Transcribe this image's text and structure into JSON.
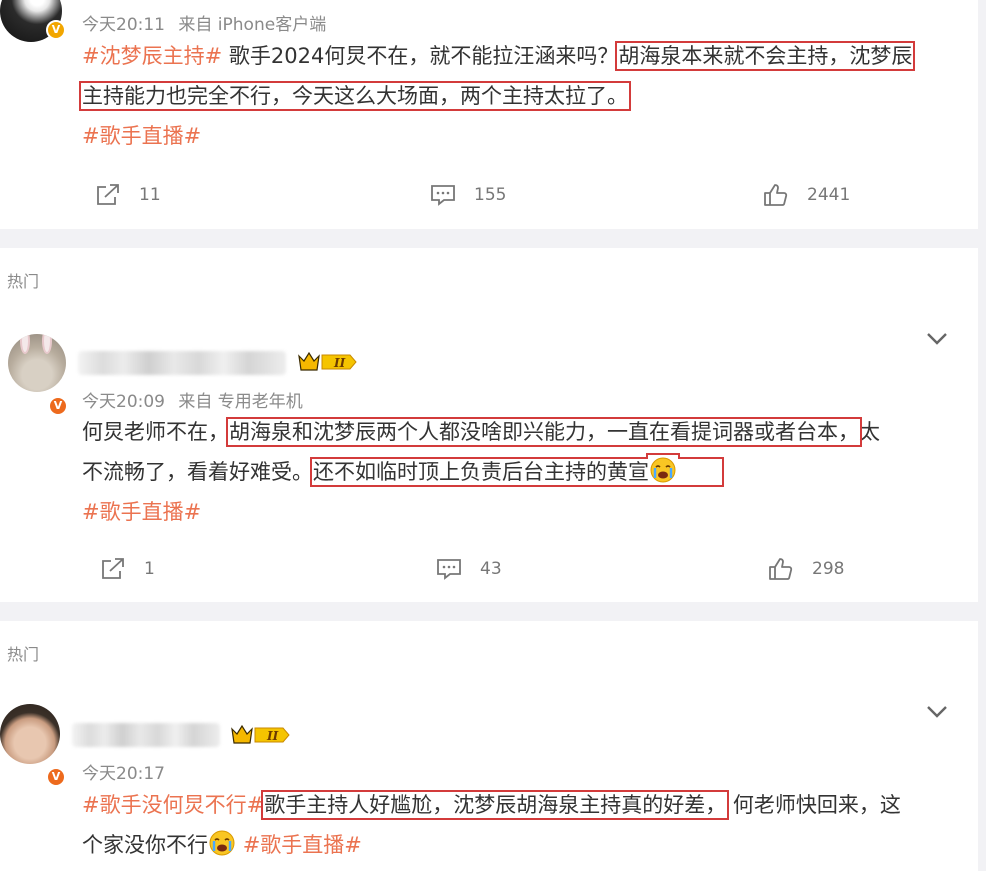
{
  "comments": [
    {
      "meta": {
        "time": "今天20:11",
        "source": "来自 iPhone客户端"
      },
      "text": {
        "line1_topic": "#沈梦辰主持#",
        "line1_plain": " 歌手2024何炅不在，就不能拉汪涵来吗？",
        "line1_hl": "胡海泉本来就不会主持，沈梦辰",
        "line2_hl": "主持能力也完全不行，今天这么大场面，两个主持太拉了。",
        "line3_topic": "#歌手直播#"
      },
      "actions": {
        "repost": "11",
        "comments": "155",
        "likes": "2441"
      }
    },
    {
      "section_label": "热门",
      "meta": {
        "time": "今天20:09",
        "source": "来自 专用老年机"
      },
      "text": {
        "line1_plain": "何炅老师不在，",
        "line1_hl": "胡海泉和沈梦辰两个人都没啥即兴能力，一直在看提词器或者台本，",
        "line1_tail": "太",
        "line2_plain": "不流畅了，看着好难受。",
        "line2_hl": "还不如临时顶上负责后台主持的黄宣",
        "line3_topic": "#歌手直播#"
      },
      "actions": {
        "repost": "1",
        "comments": "43",
        "likes": "298"
      }
    },
    {
      "section_label": "热门",
      "meta": {
        "time": "今天20:17"
      },
      "text": {
        "line1_topic": "#歌手没何炅不行#",
        "line1_hl": "歌手主持人好尴尬，沈梦辰胡海泉主持真的好差，",
        "line1_tail": " 何老师快回来，这",
        "line2_plain": "个家没你不行",
        "line2_topic": "#歌手直播#"
      }
    }
  ],
  "vip_level": "II",
  "verified_badge": "V",
  "icons": [
    "repost-icon",
    "comment-icon",
    "like-icon",
    "chevron-down-icon",
    "crown-icon",
    "sob-emoji"
  ],
  "colors": {
    "topic": "#eb7350",
    "highlight_box": "#d33b3b",
    "muted": "#8a8a8a",
    "verified_gold": "#f2a600",
    "verified_orange": "#ed6a1d"
  }
}
